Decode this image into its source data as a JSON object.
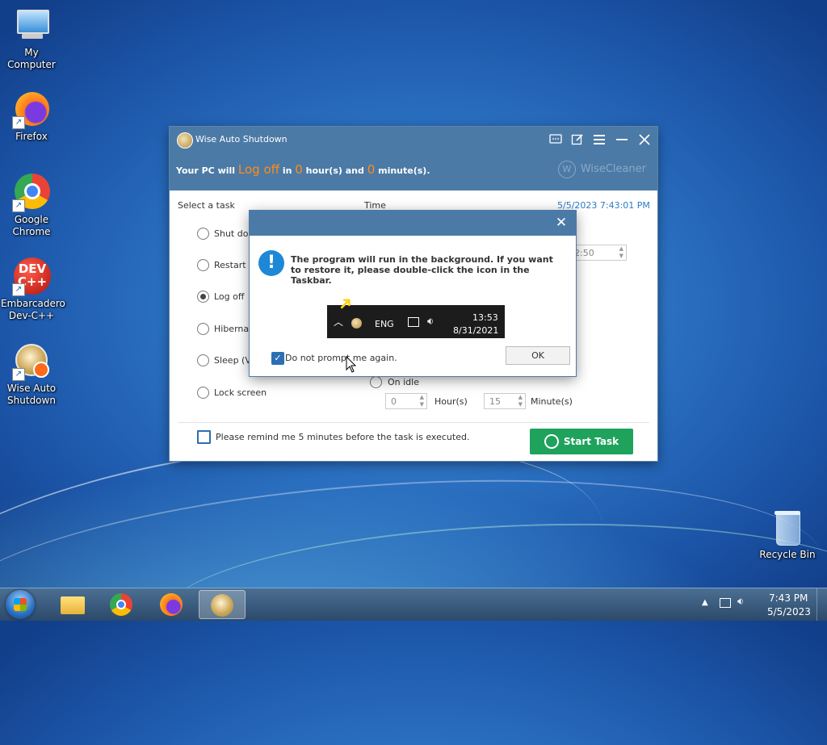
{
  "desktop": {
    "icons": [
      {
        "label": "My Computer"
      },
      {
        "label": "Firefox"
      },
      {
        "label": "Google Chrome"
      },
      {
        "label": "Embarcadero Dev-C++"
      },
      {
        "label": "Wise Auto Shutdown"
      },
      {
        "label": "Recycle Bin"
      }
    ]
  },
  "app": {
    "title": "Wise Auto Shutdown",
    "status": {
      "prefix": "Your PC will",
      "action": "Log off",
      "in": "in",
      "hours": "0",
      "hours_suffix": "hour(s) and",
      "minutes": "0",
      "minutes_suffix": "minute(s)."
    },
    "brand": "WiseCleaner",
    "brand_mark": "W",
    "select_task_label": "Select a task",
    "time_label": "Time",
    "datetime": "5/5/2023 7:43:01 PM",
    "tasks": [
      "Shut down",
      "Restart",
      "Log off",
      "Hibernate",
      "Sleep (Vista and later)",
      "Lock screen"
    ],
    "time_partial_value": "2:50",
    "on_idle_label": "On idle",
    "idle_hours": "0",
    "hours_unit": "Hour(s)",
    "idle_minutes": "15",
    "minutes_unit": "Minute(s)",
    "remind_label": "Please remind me 5 minutes before the task is executed.",
    "start_button": "Start Task"
  },
  "modal": {
    "close": "✕",
    "message": "The program will run in the background. If you want to restore it, please double-click the icon in the Taskbar.",
    "preview": {
      "lang": "ENG",
      "time": "13:53",
      "date": "8/31/2021"
    },
    "dont_prompt_label": "Do not prompt me again.",
    "ok_button": "OK"
  },
  "taskbar": {
    "time": "7:43 PM",
    "date": "5/5/2023"
  }
}
